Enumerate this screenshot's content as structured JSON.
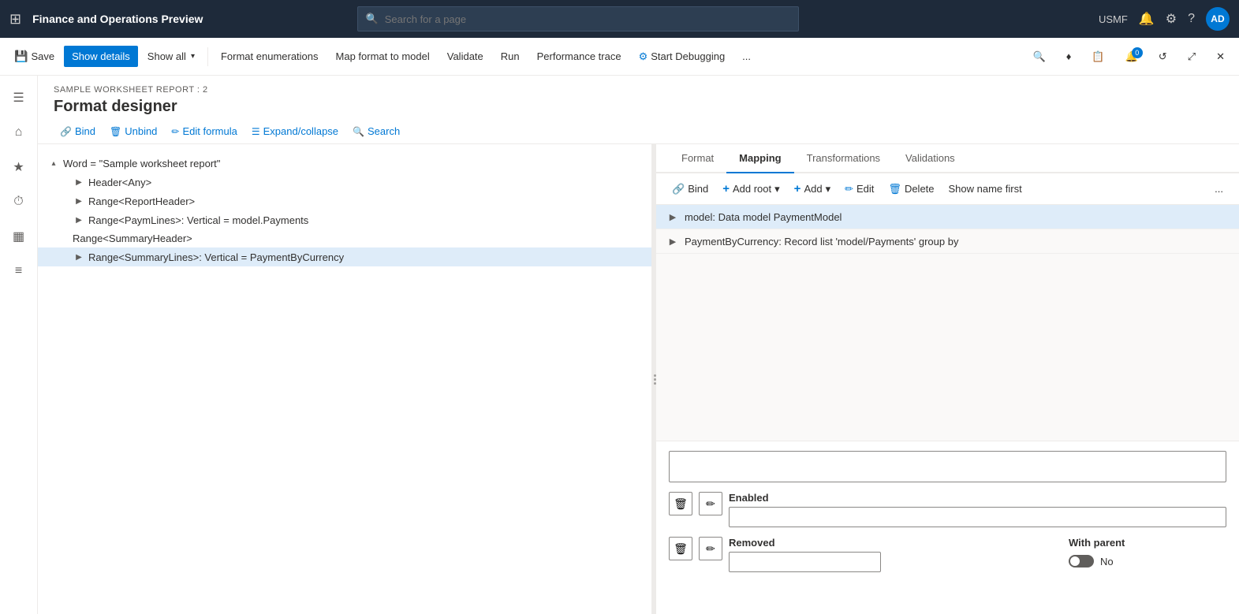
{
  "topnav": {
    "app_grid_icon": "⊞",
    "title": "Finance and Operations Preview",
    "search_placeholder": "Search for a page",
    "user_org": "USMF",
    "user_initials": "AD",
    "notification_icon": "🔔",
    "settings_icon": "⚙",
    "help_icon": "?"
  },
  "commandbar": {
    "save_label": "Save",
    "show_details_label": "Show details",
    "show_all_label": "Show all",
    "format_enumerations_label": "Format enumerations",
    "map_format_label": "Map format to model",
    "validate_label": "Validate",
    "run_label": "Run",
    "performance_trace_label": "Performance trace",
    "start_debugging_label": "Start Debugging",
    "more_label": "...",
    "refresh_icon": "↺",
    "fullscreen_icon": "⤢",
    "close_icon": "✕"
  },
  "sidebar_icons": [
    "☰",
    "⌂",
    "★",
    "⏱",
    "▦",
    "≡"
  ],
  "page": {
    "breadcrumb": "SAMPLE WORKSHEET REPORT : 2",
    "title": "Format designer"
  },
  "subtoolbar": {
    "bind_label": "Bind",
    "unbind_label": "Unbind",
    "edit_formula_label": "Edit formula",
    "expand_collapse_label": "Expand/collapse",
    "search_label": "Search"
  },
  "tree": {
    "nodes": [
      {
        "id": "word",
        "label": "Word = \"Sample worksheet report\"",
        "level": 0,
        "expanded": true,
        "selected": false
      },
      {
        "id": "header",
        "label": "Header<Any>",
        "level": 1,
        "expanded": false,
        "selected": false
      },
      {
        "id": "range_report",
        "label": "Range<ReportHeader>",
        "level": 1,
        "expanded": false,
        "selected": false
      },
      {
        "id": "range_paymlines",
        "label": "Range<PaymLines>: Vertical = model.Payments",
        "level": 1,
        "expanded": false,
        "selected": false
      },
      {
        "id": "range_summary",
        "label": "Range<SummaryHeader>",
        "level": 1,
        "expanded": false,
        "selected": false
      },
      {
        "id": "range_summarylines",
        "label": "Range<SummaryLines>: Vertical = PaymentByCurrency",
        "level": 1,
        "expanded": false,
        "selected": true
      }
    ]
  },
  "right_panel": {
    "tabs": [
      {
        "id": "format",
        "label": "Format",
        "active": false
      },
      {
        "id": "mapping",
        "label": "Mapping",
        "active": true
      },
      {
        "id": "transformations",
        "label": "Transformations",
        "active": false
      },
      {
        "id": "validations",
        "label": "Validations",
        "active": false
      }
    ],
    "mapping_toolbar": {
      "bind_label": "Bind",
      "add_root_label": "Add root",
      "add_label": "Add",
      "edit_label": "Edit",
      "delete_label": "Delete",
      "show_name_first_label": "Show name first",
      "more_label": "..."
    },
    "mapping_nodes": [
      {
        "id": "model",
        "label": "model: Data model PaymentModel",
        "level": 0,
        "expanded": false,
        "selected": true
      },
      {
        "id": "payment_by_currency",
        "label": "PaymentByCurrency: Record list 'model/Payments' group by",
        "level": 0,
        "expanded": false,
        "selected": false
      }
    ]
  },
  "bottom_panel": {
    "enabled_label": "Enabled",
    "removed_label": "Removed",
    "with_parent_label": "With parent",
    "no_label": "No",
    "enabled_value": "",
    "removed_value": ""
  }
}
